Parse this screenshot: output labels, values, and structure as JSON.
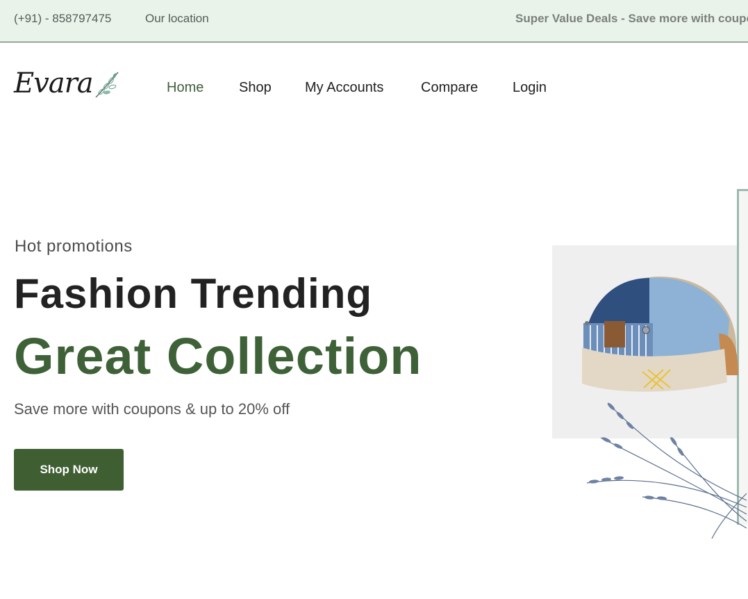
{
  "topbar": {
    "phone": "(+91) - 858797475",
    "location": "Our location",
    "deals": "Super Value Deals - Save more with coupons"
  },
  "brand": {
    "logo": "Evara"
  },
  "nav": {
    "items": [
      "Home",
      "Shop",
      "My Accounts",
      "Compare",
      "Login"
    ],
    "active": "Home"
  },
  "hero": {
    "subtitle": "Hot promotions",
    "title_line1": "Fashion Trending",
    "title_line2": "Great Collection",
    "description": "Save more with coupons & up to 20% off",
    "cta": "Shop Now",
    "image_alt": "denim patchwork cap"
  },
  "colors": {
    "topbar_bg": "#e9f3ea",
    "brand_green": "#3f5f33",
    "text_dark": "#222222"
  }
}
